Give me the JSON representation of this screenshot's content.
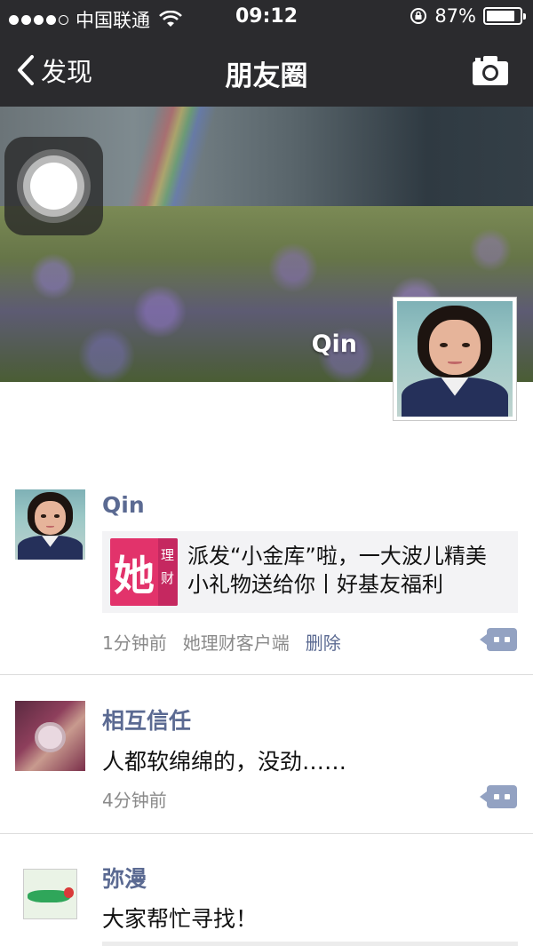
{
  "status_bar": {
    "carrier": "中国联通",
    "time": "09:12",
    "battery": "87%",
    "battery_level": 0.87
  },
  "nav": {
    "back_label": "发现",
    "title": "朋友圈"
  },
  "cover": {
    "user_name": "Qin"
  },
  "posts": [
    {
      "author": "Qin",
      "share": {
        "logo_big": "她",
        "logo_small_1": "理",
        "logo_small_2": "财",
        "title": "派发“小金库”啦，一大波儿精美小礼物送给你丨好基友福利"
      },
      "time": "1分钟前",
      "source": "她理财客户端",
      "delete_label": "删除"
    },
    {
      "author": "相互信任",
      "text": "人都软绵绵的，没劲……",
      "time": "4分钟前"
    },
    {
      "author": "弥漫",
      "text": "大家帮忙寻找！"
    }
  ],
  "colors": {
    "nav_bg": "#2b2b2e",
    "link_blue": "#5b6a92",
    "comment_button": "#93a2c2",
    "brand_pink": "#e2336b"
  },
  "icons": [
    "back-chevron-icon",
    "camera-icon",
    "wifi-icon",
    "lock-rotation-icon",
    "battery-icon",
    "comment-icon"
  ]
}
